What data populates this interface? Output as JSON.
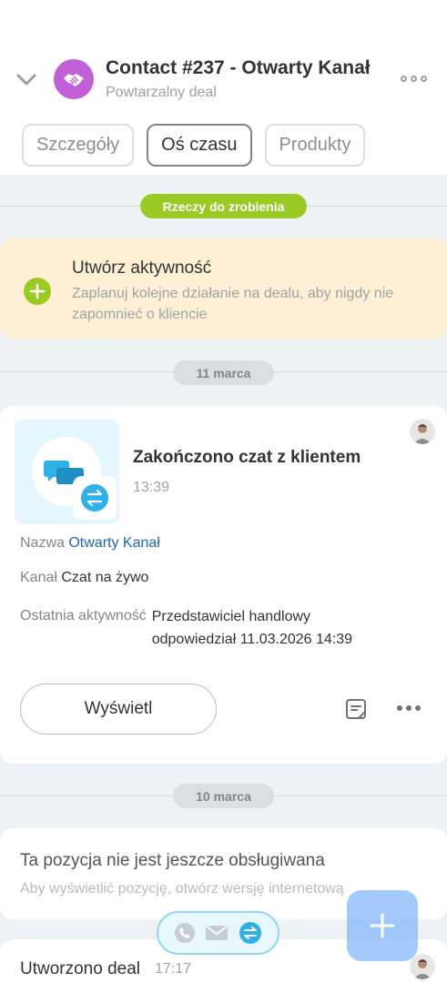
{
  "header": {
    "title": "Contact #237 - Otwarty Kanał",
    "subtitle": "Powtarzalny deal",
    "deal_icon_color": "#c15fd6"
  },
  "tabs": [
    {
      "label": "Szczegóły",
      "active": false
    },
    {
      "label": "Oś czasu",
      "active": true
    },
    {
      "label": "Produkty",
      "active": false
    }
  ],
  "timeline": {
    "todo_label": "Rzeczy do zrobienia",
    "create_activity": {
      "title": "Utwórz aktywność",
      "description": "Zaplanuj kolejne działanie na dealu, aby nigdy nie zapomnieć o kliencie"
    },
    "date1": "11 marca",
    "chat": {
      "title": "Zakończono czat z klientem",
      "time": "13:39",
      "name_label": "Nazwa",
      "name_value": "Otwarty Kanał",
      "channel_label": "Kanał",
      "channel_value": "Czat na żywo",
      "last_activity_label": "Ostatnia aktywność",
      "last_activity_value": "Przedstawiciel handlowy odpowiedział 11.03.2026 14:39",
      "view_button": "Wyświetl"
    },
    "date2": "10 marca",
    "unsupported": {
      "title": "Ta pozycja nie jest jeszcze obsługiwana",
      "description": "Aby wyświetlić pozycję, otwórz wersję internetową"
    },
    "deal_created": {
      "title": "Utworzono deal",
      "time": "17:17"
    }
  },
  "colors": {
    "accent_green": "#9acb24",
    "link_blue": "#2067b0",
    "chat_blue": "#2fb1e8"
  }
}
